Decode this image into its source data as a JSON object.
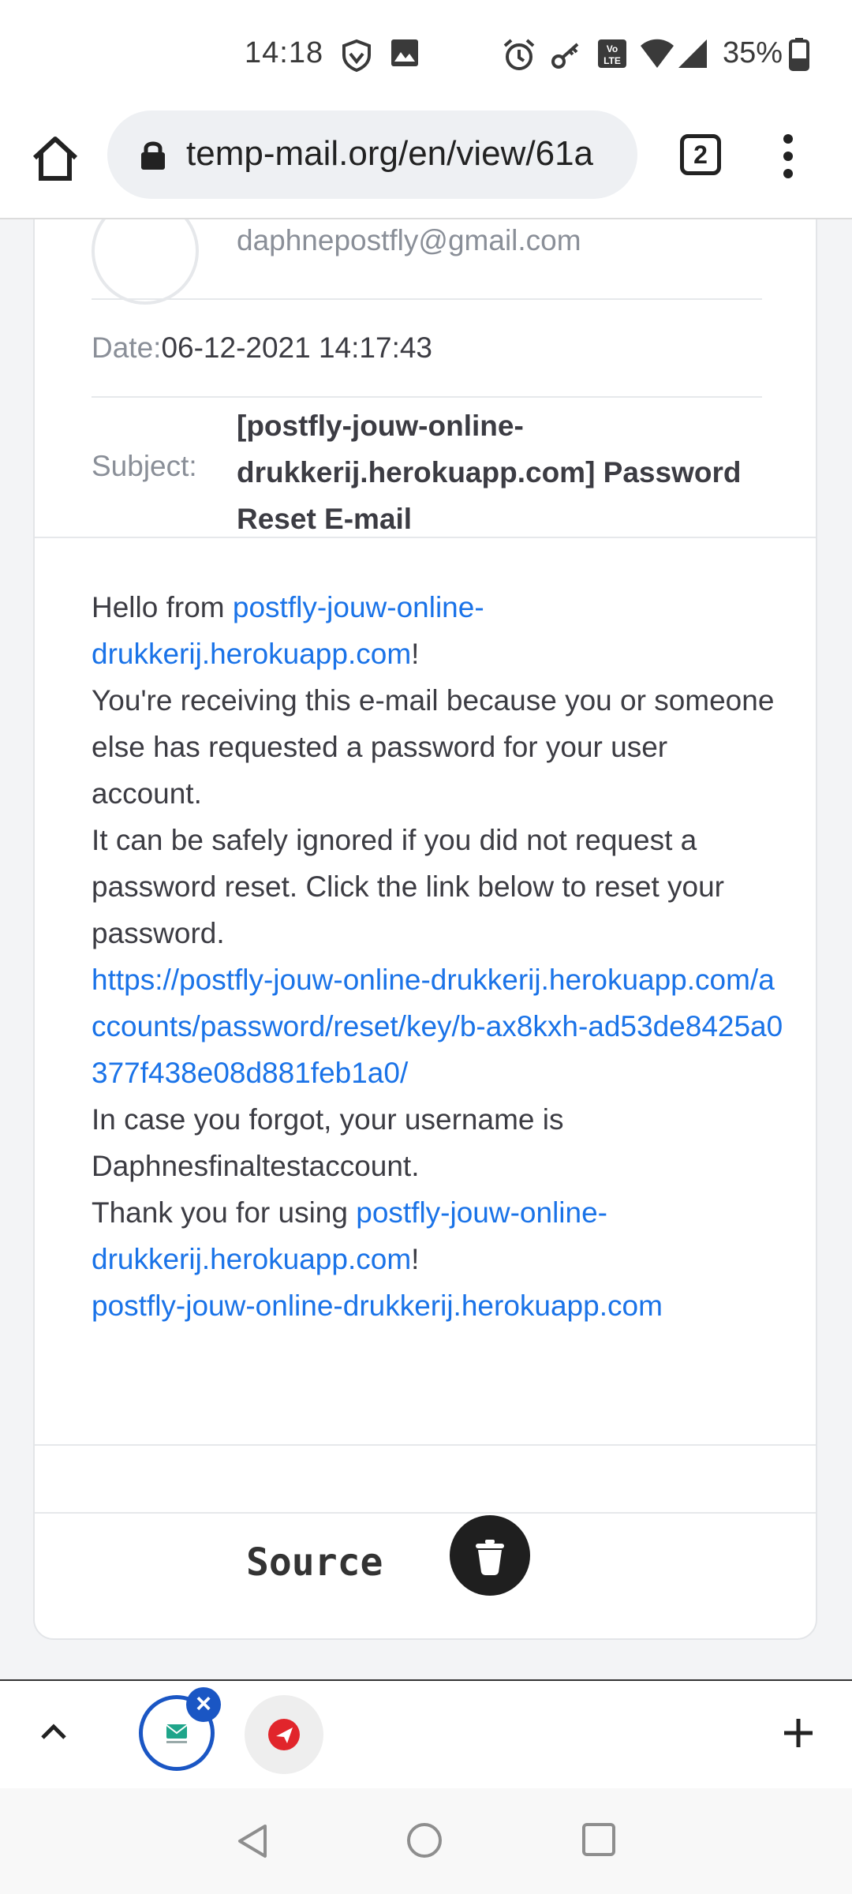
{
  "status_bar": {
    "time": "14:18",
    "battery": "35%",
    "icons": [
      "vpn-shield-icon",
      "image-icon",
      "alarm-icon",
      "key-icon",
      "volte-icon",
      "wifi-icon",
      "signal-icon",
      "battery-icon"
    ]
  },
  "browser": {
    "url": "temp-mail.org/en/view/61a",
    "tab_count": "2"
  },
  "email": {
    "from_email": "daphnepostfly@gmail.com",
    "date_label": "Date:",
    "date_value": "06-12-2021 14:17:43",
    "subject_label": "Subject:",
    "subject_value": "[postfly-jouw-online-drukkerij.herokuapp.com] Password Reset E-mail",
    "body": {
      "hello_prefix": "Hello from ",
      "site_link": "postfly-jouw-online-drukkerij.herokuapp.com",
      "exclaim": "!",
      "line_receiving": "You're receiving this e-mail because you or someone else has requested a password for your user account.",
      "line_ignore": "It can be safely ignored if you did not request a password reset. Click the link below to reset your password.",
      "reset_link": "https://postfly-jouw-online-drukkerij.herokuapp.com/accounts/password/reset/key/b-ax8kxh-ad53de8425a0377f438e08d881feb1a0/",
      "line_username": "In case you forgot, your username is Daphnesfinaltestaccount.",
      "thanks_prefix": "Thank you for using ",
      "site_link_2": "postfly-jouw-online-drukkerij.herokuapp.com",
      "exclaim_2": "!",
      "footer_link": "postfly-jouw-online-drukkerij.herokuapp.com"
    },
    "source_label": "Source"
  },
  "tab_strip": {
    "active_tab_close": "×"
  }
}
